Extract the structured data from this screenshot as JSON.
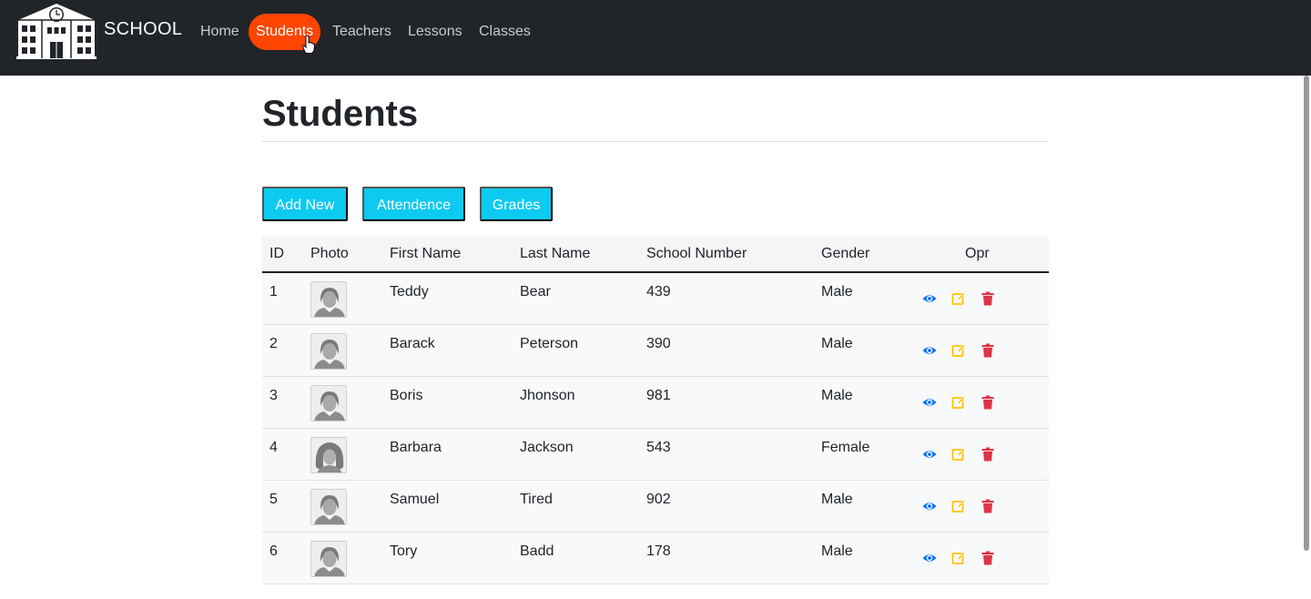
{
  "brand": {
    "name": "SCHOOL"
  },
  "nav": {
    "items": [
      {
        "label": "Home"
      },
      {
        "label": "Students"
      },
      {
        "label": "Teachers"
      },
      {
        "label": "Lessons"
      },
      {
        "label": "Classes"
      }
    ],
    "active": "Students"
  },
  "page": {
    "title": "Students"
  },
  "actions": {
    "add_new": "Add New",
    "attendence": "Attendence",
    "grades": "Grades"
  },
  "table": {
    "headers": {
      "id": "ID",
      "photo": "Photo",
      "first_name": "First Name",
      "last_name": "Last Name",
      "school_number": "School Number",
      "gender": "Gender",
      "opr": "Opr"
    },
    "rows": [
      {
        "id": "1",
        "first_name": "Teddy",
        "last_name": "Bear",
        "school_number": "439",
        "gender": "Male"
      },
      {
        "id": "2",
        "first_name": "Barack",
        "last_name": "Peterson",
        "school_number": "390",
        "gender": "Male"
      },
      {
        "id": "3",
        "first_name": "Boris",
        "last_name": "Jhonson",
        "school_number": "981",
        "gender": "Male"
      },
      {
        "id": "4",
        "first_name": "Barbara",
        "last_name": "Jackson",
        "school_number": "543",
        "gender": "Female"
      },
      {
        "id": "5",
        "first_name": "Samuel",
        "last_name": "Tired",
        "school_number": "902",
        "gender": "Male"
      },
      {
        "id": "6",
        "first_name": "Tory",
        "last_name": "Badd",
        "school_number": "178",
        "gender": "Male"
      }
    ]
  },
  "colors": {
    "navbar": "#212529",
    "nav_active": "#ff4500",
    "button": "#0dcaf0",
    "view_icon": "#0d6efd",
    "edit_icon": "#ffc107",
    "delete_icon": "#dc3545"
  },
  "icons": {
    "logo": "school-building-icon",
    "view": "eye-icon",
    "edit": "edit-icon",
    "delete": "trash-icon",
    "male_photo": "male-avatar-icon",
    "female_photo": "female-avatar-icon"
  }
}
